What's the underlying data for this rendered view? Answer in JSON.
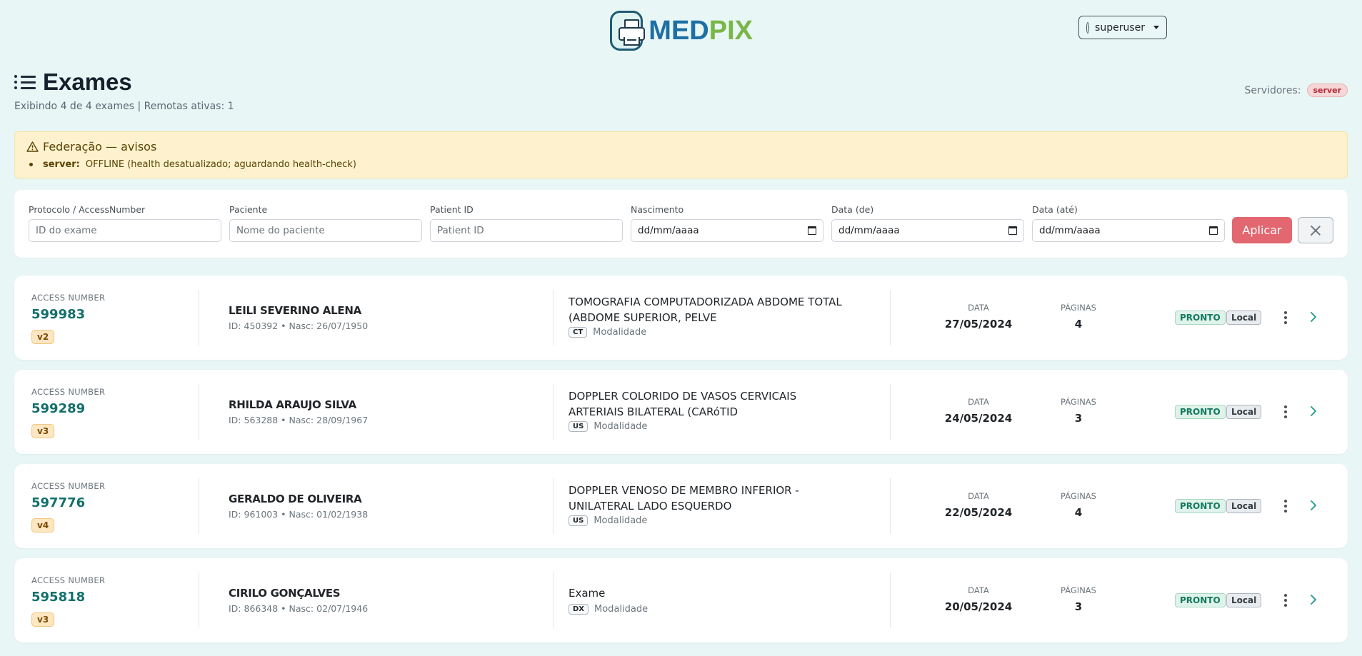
{
  "header": {
    "logo_part1": "MED",
    "logo_part2": "PIX",
    "user_label": "superuser"
  },
  "page": {
    "title": "Exames",
    "subtitle": "Exibindo 4 de 4 exames | Remotas ativas: 1",
    "servers_label": "Servidores:",
    "server_badge": "server"
  },
  "alert": {
    "title": "Federação — avisos",
    "item_server": "server:",
    "item_text": "OFFLINE (health desatualizado; aguardando health-check)"
  },
  "filters": {
    "protocol": {
      "label": "Protocolo / AccessNumber",
      "placeholder": "ID do exame"
    },
    "patient": {
      "label": "Paciente",
      "placeholder": "Nome do paciente"
    },
    "patient_id": {
      "label": "Patient ID",
      "placeholder": "Patient ID"
    },
    "birth": {
      "label": "Nascimento",
      "value": "dd/mm/aaaa"
    },
    "date_from": {
      "label": "Data (de)",
      "value": "dd/mm/aaaa"
    },
    "date_to": {
      "label": "Data (até)",
      "value": "dd/mm/aaaa"
    },
    "apply_label": "Aplicar"
  },
  "exams": [
    {
      "access_label": "ACCESS NUMBER",
      "access_number": "599983",
      "version": "v2",
      "patient_name": "LEILI SEVERINO ALENA",
      "patient_meta": "ID: 450392 • Nasc: 26/07/1950",
      "exam_name": "TOMOGRAFIA COMPUTADORIZADA ABDOME TOTAL (ABDOME SUPERIOR, PELVE",
      "modality": "CT",
      "modality_label": "Modalidade",
      "date_label": "DATA",
      "date": "27/05/2024",
      "pages_label": "PÁGINAS",
      "pages": "4",
      "status": "PRONTO",
      "source": "Local"
    },
    {
      "access_label": "ACCESS NUMBER",
      "access_number": "599289",
      "version": "v3",
      "patient_name": "RHILDA ARAUJO SILVA",
      "patient_meta": "ID: 563288 • Nasc: 28/09/1967",
      "exam_name": "DOPPLER COLORIDO DE VASOS CERVICAIS ARTERIAIS BILATERAL (CARóTID",
      "modality": "US",
      "modality_label": "Modalidade",
      "date_label": "DATA",
      "date": "24/05/2024",
      "pages_label": "PÁGINAS",
      "pages": "3",
      "status": "PRONTO",
      "source": "Local"
    },
    {
      "access_label": "ACCESS NUMBER",
      "access_number": "597776",
      "version": "v4",
      "patient_name": "GERALDO DE OLIVEIRA",
      "patient_meta": "ID: 961003 • Nasc: 01/02/1938",
      "exam_name": "DOPPLER VENOSO DE MEMBRO INFERIOR - UNILATERAL LADO ESQUERDO",
      "modality": "US",
      "modality_label": "Modalidade",
      "date_label": "DATA",
      "date": "22/05/2024",
      "pages_label": "PÁGINAS",
      "pages": "4",
      "status": "PRONTO",
      "source": "Local"
    },
    {
      "access_label": "ACCESS NUMBER",
      "access_number": "595818",
      "version": "v3",
      "patient_name": "CIRILO GONÇALVES",
      "patient_meta": "ID: 866348 • Nasc: 02/07/1946",
      "exam_name": "Exame",
      "modality": "DX",
      "modality_label": "Modalidade",
      "date_label": "DATA",
      "date": "20/05/2024",
      "pages_label": "PÁGINAS",
      "pages": "3",
      "status": "PRONTO",
      "source": "Local"
    }
  ]
}
